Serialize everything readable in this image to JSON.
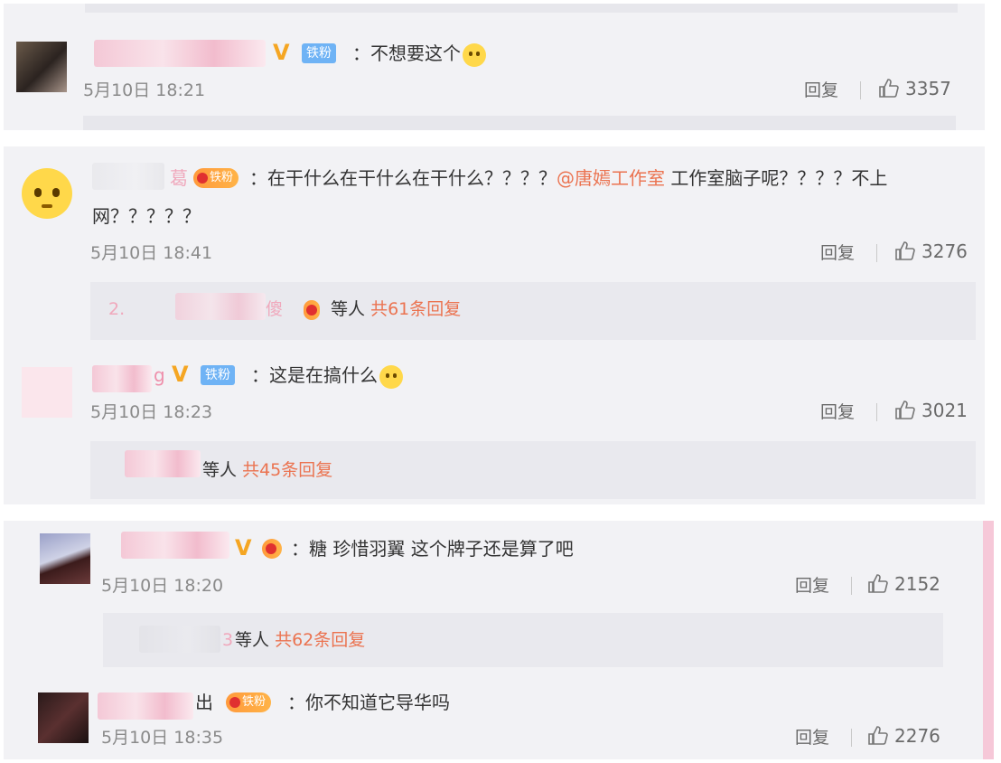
{
  "comments": [
    {
      "badge": "铁粉",
      "text": "：不想要这个",
      "time": "5月10日 18:21",
      "reply_label": "回复",
      "likes": "3357"
    },
    {
      "name_tail": "葛",
      "badge": "铁粉",
      "text_before": "：在干什么在干什么在干什么？？？？",
      "mention": "@唐嫣工作室",
      "text_after": " 工作室脑子呢？？？？不上",
      "text_line2": "网？？？？？",
      "time": "5月10日 18:41",
      "reply_label": "回复",
      "likes": "3276",
      "sub_name_fragment": "2.",
      "sub_name_tail": "傻",
      "sub_people": "等人",
      "sub_count": "共61条回复"
    },
    {
      "name_tail": "g",
      "badge": "铁粉",
      "text": "：这是在搞什么",
      "time": "5月10日 18:23",
      "reply_label": "回复",
      "likes": "3021",
      "sub_people": "等人",
      "sub_count": "共45条回复"
    },
    {
      "text": "：糖 珍惜羽翼 这个牌子还是算了吧",
      "time": "5月10日 18:20",
      "reply_label": "回复",
      "likes": "2152",
      "sub_name_tail": "3",
      "sub_people": "等人",
      "sub_count": "共62条回复"
    },
    {
      "name_tail": "出",
      "badge": "铁粉",
      "text": "：你不知道它导华吗",
      "time": "5月10日 18:35",
      "reply_label": "回复",
      "likes": "2276"
    }
  ],
  "colors": {
    "card_bg": "#f2f2f5",
    "accent_link": "#eb7350",
    "vip_v": "#f5a623",
    "fan_badge": "#6fb3f5"
  }
}
